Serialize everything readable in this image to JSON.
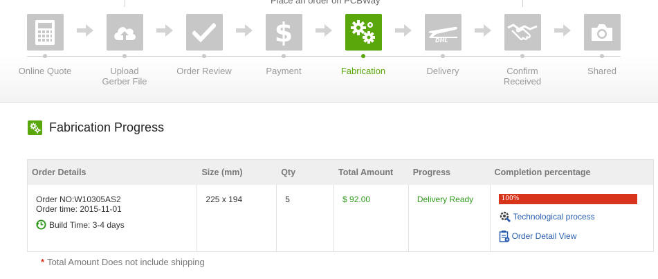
{
  "banner": "Place an order on PCBWay",
  "steps": [
    {
      "label": "Online Quote",
      "icon": "calculator-icon",
      "active": false
    },
    {
      "label": "Upload\nGerber File",
      "icon": "cloud-upload-icon",
      "active": false
    },
    {
      "label": "Order Review",
      "icon": "checkmark-icon",
      "active": false
    },
    {
      "label": "Payment",
      "icon": "dollar-icon",
      "active": false
    },
    {
      "label": "Fabrication",
      "icon": "gears-icon",
      "active": true
    },
    {
      "label": "Delivery",
      "icon": "dhl-plane-icon",
      "active": false
    },
    {
      "label": "Confirm\nReceived",
      "icon": "handshake-icon",
      "active": false
    },
    {
      "label": "Shared",
      "icon": "camera-icon",
      "active": false
    }
  ],
  "section": {
    "title": "Fabrication Progress",
    "icon": "gears-icon"
  },
  "table": {
    "headers": [
      "Order Details",
      "Size (mm)",
      "Qty",
      "Total Amount",
      "Progress",
      "Completion percentage"
    ],
    "row": {
      "order_no": "Order NO:W10305AS2",
      "order_time": "Order time: 2015-11-01",
      "build_time": "Build Time: 3-4 days",
      "size": "225 x 194",
      "qty": "5",
      "total": "$ 92.00",
      "progress": "Delivery Ready",
      "completion_label": "100%",
      "completion_value": 1.0,
      "link_process": "Technological process",
      "link_detail": "Order Detail View"
    }
  },
  "note": "Total Amount Does not include shipping",
  "colors": {
    "accent": "#5aa70c",
    "step_gray": "#c7c7c7",
    "progress_bar": "#d8341c",
    "link": "#2a5fb0"
  }
}
